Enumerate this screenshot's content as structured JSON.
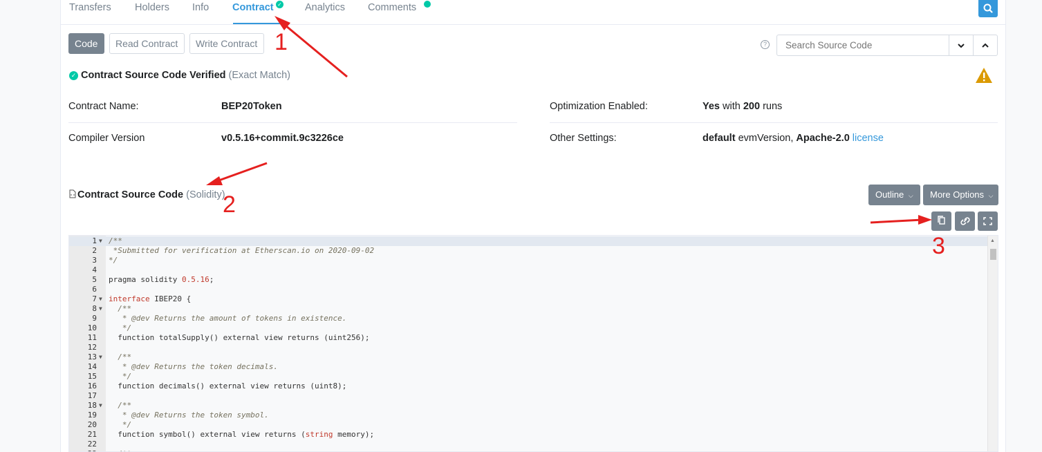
{
  "tabs": {
    "items": [
      "Transfers",
      "Holders",
      "Info",
      "Contract",
      "Analytics",
      "Comments"
    ],
    "active": "Contract"
  },
  "code_tabs": [
    "Code",
    "Read Contract",
    "Write Contract"
  ],
  "search": {
    "placeholder": "Search Source Code"
  },
  "verified": {
    "label": "Contract Source Code Verified",
    "note": "(Exact Match)"
  },
  "details": {
    "contract_name_label": "Contract Name:",
    "contract_name": "BEP20Token",
    "compiler_label": "Compiler Version",
    "compiler": "v0.5.16+commit.9c3226ce",
    "optimization_label": "Optimization Enabled:",
    "optimization_yes": "Yes",
    "optimization_with": "with",
    "optimization_runs": "200",
    "optimization_runs_word": "runs",
    "other_label": "Other Settings:",
    "other_default": "default",
    "other_evm": "evmVersion,",
    "other_license_name": "Apache-2.0",
    "other_license_link": "license"
  },
  "source": {
    "title": "Contract Source Code",
    "language": "(Solidity)"
  },
  "buttons": {
    "outline": "Outline",
    "more_options": "More Options"
  },
  "icons": {
    "copy": "copy-icon",
    "link": "link-icon",
    "fullscreen": "fullscreen-icon",
    "search": "search-icon",
    "warning": "warning-icon"
  },
  "colors": {
    "accent": "#3498db",
    "verified": "#00c9a7",
    "button": "#77838f",
    "annotation": "#e5201f",
    "warning": "#db9a04"
  },
  "code_lines": [
    "/**",
    " *Submitted for verification at Etherscan.io on 2020-09-02",
    "*/",
    "",
    "pragma solidity 0.5.16;",
    "",
    "interface IBEP20 {",
    "  /**",
    "   * @dev Returns the amount of tokens in existence.",
    "   */",
    "  function totalSupply() external view returns (uint256);",
    "",
    "  /**",
    "   * @dev Returns the token decimals.",
    "   */",
    "  function decimals() external view returns (uint8);",
    "",
    "  /**",
    "   * @dev Returns the token symbol.",
    "   */",
    "  function symbol() external view returns (string memory);",
    "",
    "  /**"
  ],
  "annotations": [
    "1",
    "2",
    "3"
  ]
}
